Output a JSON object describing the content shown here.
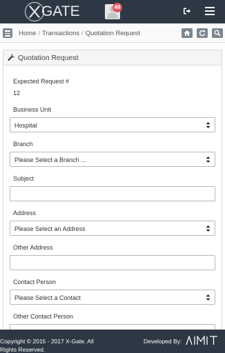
{
  "header": {
    "logo_text": "GATE",
    "notification_count": "48"
  },
  "breadcrumb": {
    "items": [
      "Home",
      "Transactions",
      "Quotation Request"
    ],
    "separator": "/"
  },
  "panel": {
    "title": "Quotation Request"
  },
  "form": {
    "expected_request_label": "Expected Request #",
    "expected_request_value": "12",
    "business_unit_label": "Business Unit",
    "business_unit_value": "Hospital",
    "branch_label": "Branch",
    "branch_value": "Please Select a Branch ...",
    "subject_label": "Subject",
    "subject_value": "",
    "address_label": "Address",
    "address_value": "Please Select an Address",
    "other_address_label": "Other Address",
    "other_address_value": "",
    "contact_person_label": "Contact Person",
    "contact_person_value": "Please Select a Contact",
    "other_contact_person_label": "Other Contact Person"
  },
  "footer": {
    "copyright": "Copyright © 2015 - 2017 X-Gate. All Rights Reserved.",
    "developed_by": "Developed By:",
    "developer_logo": "AIMIT"
  },
  "colors": {
    "topbar": "#2d3844",
    "badge": "#e2535b",
    "icon_button": "#7c8690"
  }
}
